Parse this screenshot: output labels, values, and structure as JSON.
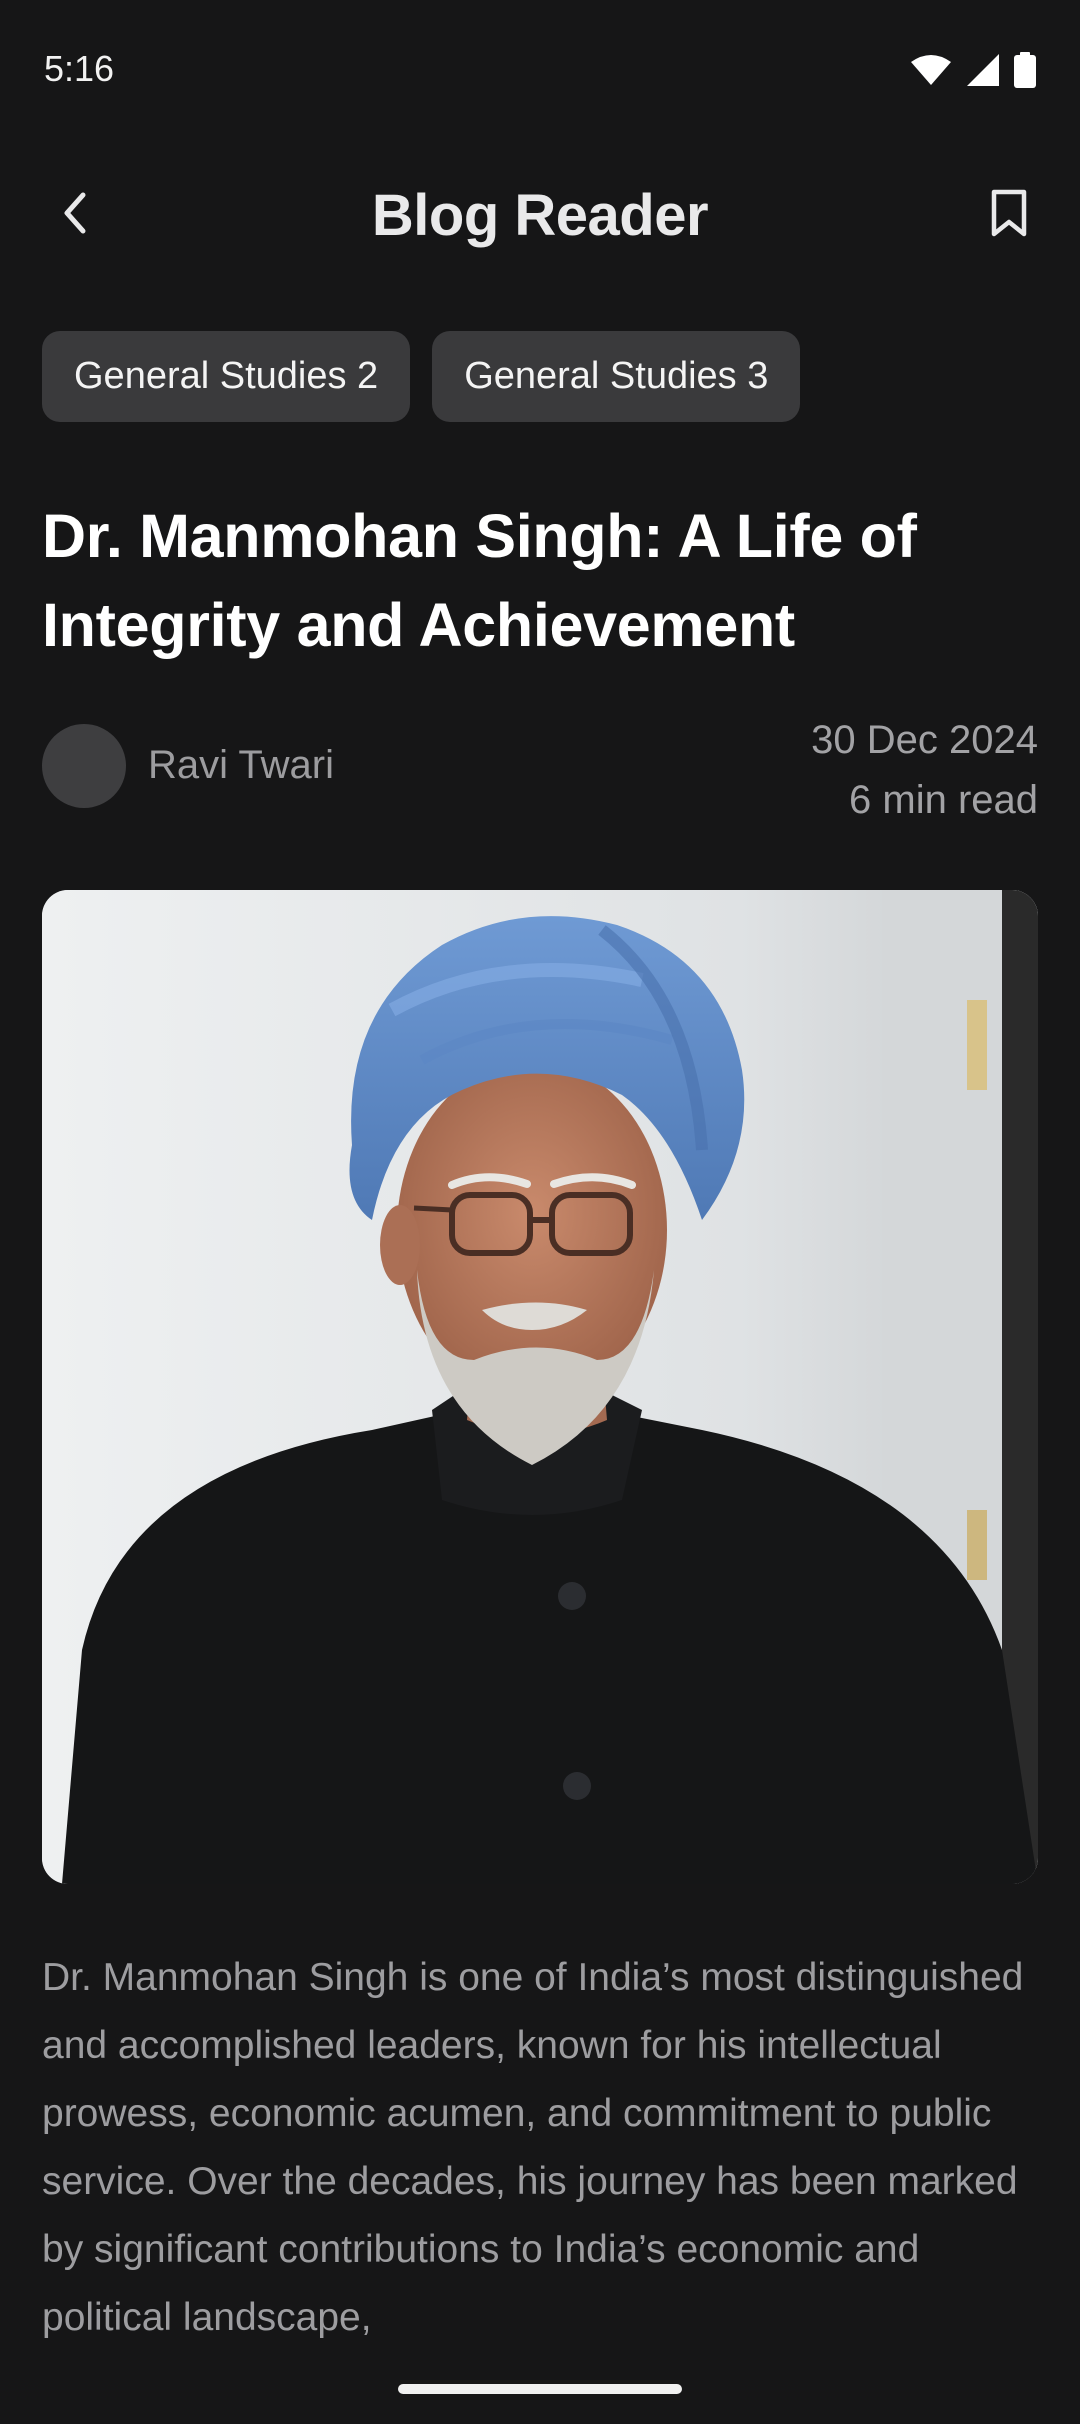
{
  "status_bar": {
    "time": "5:16",
    "icons": [
      "wifi-icon",
      "signal-icon",
      "battery-icon"
    ]
  },
  "app_bar": {
    "title": "Blog Reader",
    "back_icon": "chevron-left-icon",
    "bookmark_icon": "bookmark-icon"
  },
  "tags": [
    {
      "label": "General Studies 2"
    },
    {
      "label": "General Studies 3"
    }
  ],
  "article": {
    "title_line1": "Dr. Manmohan Singh: A Life of",
    "title_line2": "Integrity and Achievement",
    "author": "Ravi Twari",
    "date": "30 Dec 2024",
    "read_time": "6 min read",
    "body": "Dr. Manmohan Singh is one of India’s most distinguished and accomplished leaders, known for his intellectual prowess, economic acumen, and commitment to public service. Over the decades, his journey has been marked by significant contributions to India’s economic and political landscape,"
  },
  "colors": {
    "background": "#161617",
    "tag_background": "#3a3a3c",
    "title_text": "#ffffff",
    "secondary_text": "#9d9da0",
    "turban_blue": "#6f97cf"
  }
}
